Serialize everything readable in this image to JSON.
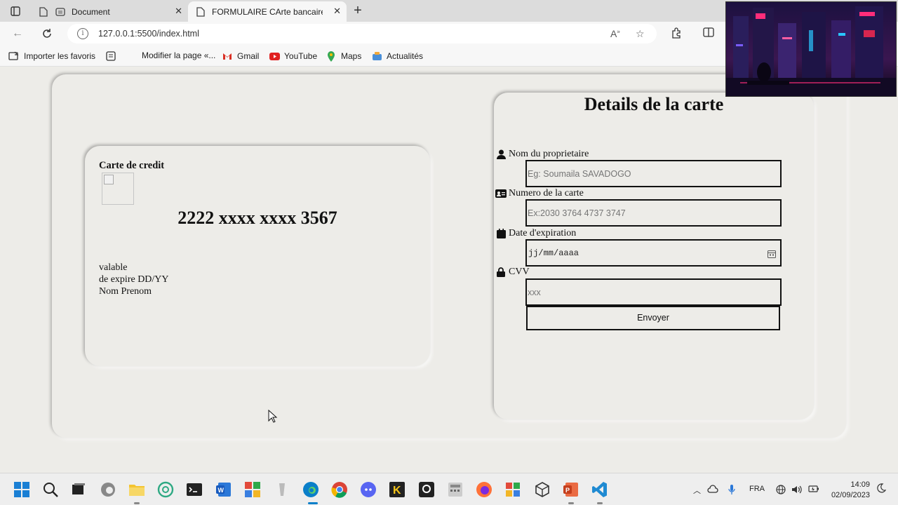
{
  "browser": {
    "tabs": [
      {
        "label": "Document",
        "active": false
      },
      {
        "label": "FORMULAIRE CArte bancaire rea",
        "active": true
      }
    ],
    "url": "127.0.0.1:5500/index.html",
    "favorites": [
      {
        "label": "Importer les favoris",
        "icon": "import-icon"
      },
      {
        "label": "Modifier la page «...",
        "icon": "page-icon"
      },
      {
        "label": "Gmail",
        "icon": "gmail-icon"
      },
      {
        "label": "YouTube",
        "icon": "youtube-icon"
      },
      {
        "label": "Maps",
        "icon": "maps-icon"
      },
      {
        "label": "Actualités",
        "icon": "news-icon"
      }
    ]
  },
  "card": {
    "title": "Carte de credit",
    "number": "2222 xxxx xxxx 3567",
    "valid_label": "valable",
    "expire_label": "de expire DD/YY",
    "holder": "Nom Prenom"
  },
  "form": {
    "title": "Details de la carte",
    "fields": [
      {
        "label": "Nom du proprietaire",
        "placeholder": "Eg: Soumaila SAVADOGO",
        "icon": "user-icon"
      },
      {
        "label": "Numero de la carte",
        "placeholder": "Ex:2030 3764 4737 3747",
        "icon": "id-card-icon"
      },
      {
        "label": "Date d'expiration",
        "value": "jj/mm/aaaa",
        "icon": "calendar-icon"
      },
      {
        "label": "CVV",
        "placeholder": "xxx",
        "icon": "lock-icon"
      }
    ],
    "submit_label": "Envoyer"
  },
  "system": {
    "language": "FRA",
    "time": "14:09",
    "date": "02/09/2023"
  },
  "colors": {
    "page_bg": "#edece8",
    "youtube_red": "#e02020",
    "edge_blue": "#0a7fc9"
  }
}
